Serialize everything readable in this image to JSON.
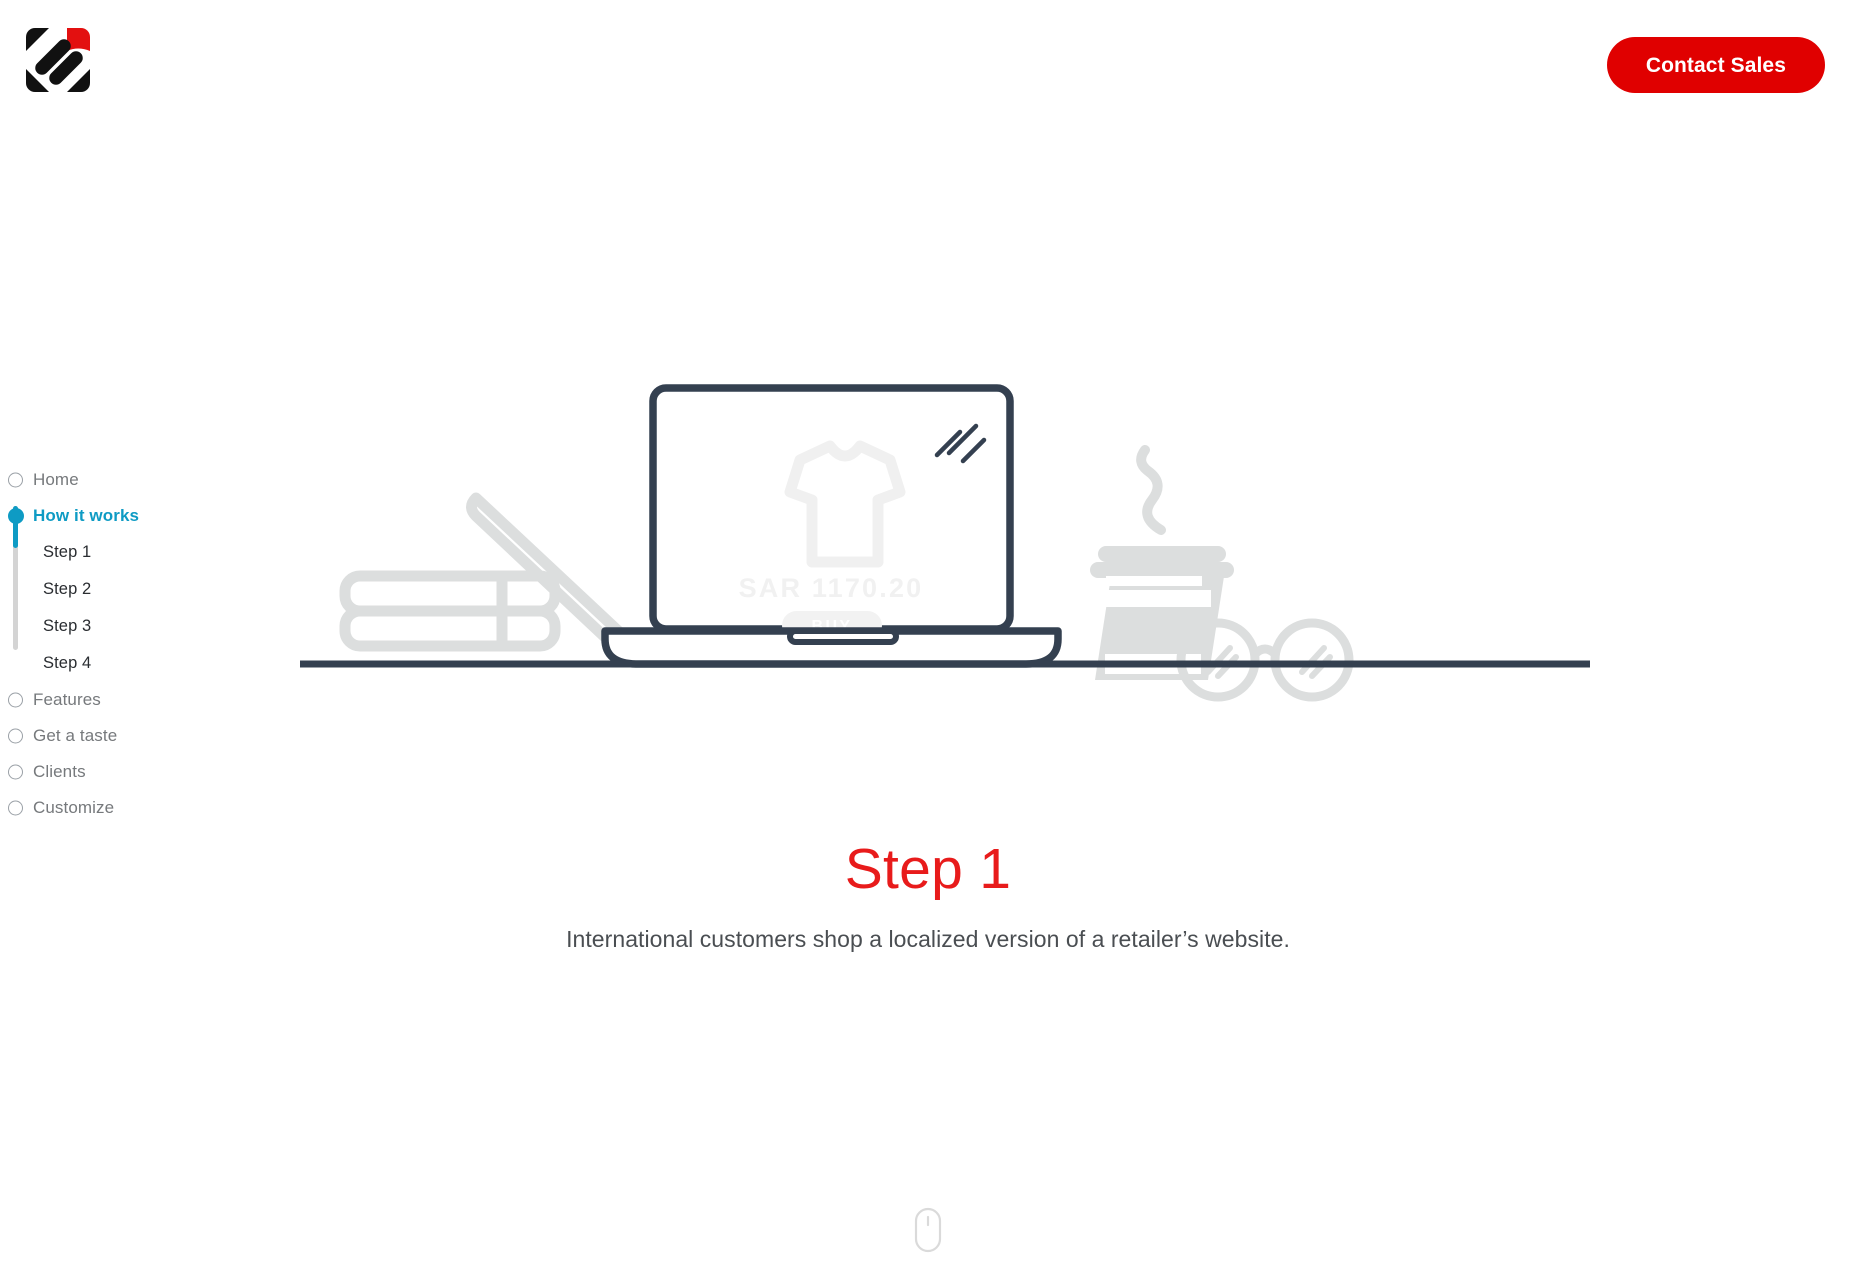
{
  "header": {
    "logo_name": "app-logo",
    "cta_label": "Contact Sales",
    "cta_color": "#E00000"
  },
  "sidebar": {
    "active_color": "#0E9BC4",
    "items": [
      {
        "label": "Home",
        "active": false
      },
      {
        "label": "How it works",
        "active": true
      },
      {
        "label": "Features",
        "active": false
      },
      {
        "label": "Get a taste",
        "active": false
      },
      {
        "label": "Clients",
        "active": false
      },
      {
        "label": "Customize",
        "active": false
      }
    ],
    "sub_items": [
      {
        "label": "Step 1"
      },
      {
        "label": "Step 2"
      },
      {
        "label": "Step 3"
      },
      {
        "label": "Step 4"
      }
    ]
  },
  "illustration": {
    "screen": {
      "product_icon": "tshirt-icon",
      "price": "SAR 1170.20",
      "buy_label": "BUY"
    },
    "objects": [
      "books-stack",
      "leaning-book",
      "laptop",
      "coffee-cup",
      "eyeglasses",
      "desk-line"
    ],
    "line_color": "#344050",
    "ghost_color": "#DCDEDE"
  },
  "main": {
    "title": "Step 1",
    "title_color": "#E81B1B",
    "description": "International customers shop a localized version of a retailer’s website."
  },
  "scroll_hint": {
    "icon": "mouse-scroll-icon"
  }
}
